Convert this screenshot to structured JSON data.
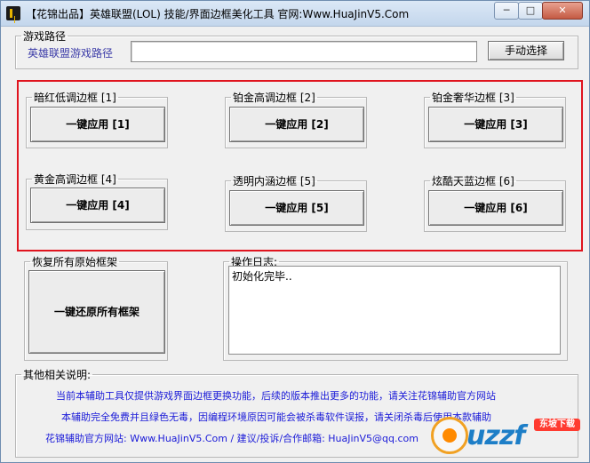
{
  "window": {
    "title": "【花锦出品】英雄联盟(LOL) 技能/界面边框美化工具 官网:Www.HuaJinV5.Com",
    "min_symbol": "─",
    "max_symbol": "□",
    "close_symbol": "✕"
  },
  "path_group": {
    "legend": "游戏路径",
    "label": "英雄联盟游戏路径",
    "path_value": "",
    "manual_select_label": "手动选择"
  },
  "frames": [
    {
      "legend": "暗红低调边框 [1]",
      "button": "一键应用 [1]"
    },
    {
      "legend": "铂金高调边框 [2]",
      "button": "一键应用 [2]"
    },
    {
      "legend": "铂金奢华边框 [3]",
      "button": "一键应用 [3]"
    },
    {
      "legend": "黄金高调边框 [4]",
      "button": "一键应用 [4]"
    },
    {
      "legend": "透明内涵边框 [5]",
      "button": "一键应用 [5]"
    },
    {
      "legend": "炫酷天蓝边框 [6]",
      "button": "一键应用 [6]"
    }
  ],
  "restore": {
    "legend": "恢复所有原始框架",
    "button": "一键还原所有框架"
  },
  "log": {
    "legend": "操作日志:",
    "text": "初始化完毕.."
  },
  "notes": {
    "legend": "其他相关说明:",
    "line1": "当前本辅助工具仅提供游戏界面边框更换功能，后续的版本推出更多的功能，请关注花锦辅助官方网站",
    "line2": "本辅助完全免费并且绿色无毒，因编程环境原因可能会被杀毒软件误报，请关闭杀毒后使用本款辅助",
    "line3": "花锦辅助官方网站: Www.HuaJinV5.Com / 建议/投诉/合作邮箱: HuaJinV5@qq.com"
  },
  "watermark": {
    "text": "uzzf",
    "badge": "东坡下载"
  },
  "colors": {
    "highlight_frame": "#e0141e",
    "note_text": "#1a1ad8",
    "path_label": "#3c3ca8"
  }
}
